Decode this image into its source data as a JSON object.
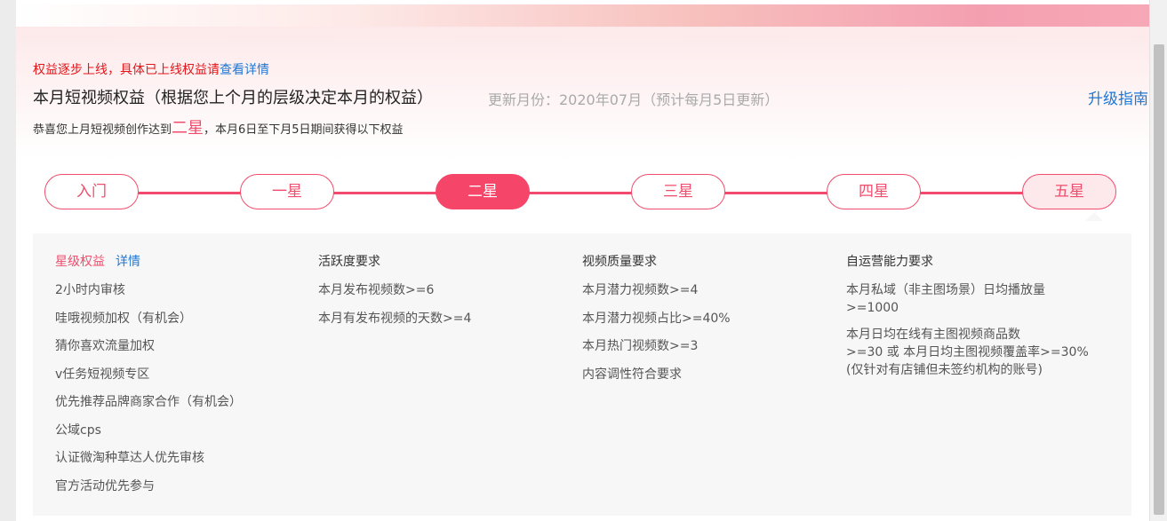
{
  "notice": {
    "text": "权益逐步上线，具体已上线权益请",
    "link": "查看详情"
  },
  "header": {
    "title": "本月短视频权益（根据您上个月的层级决定本月的权益）",
    "update_info": "更新月份：2020年07月（预计每月5日更新）",
    "upgrade_link": "升级指南"
  },
  "congrats": {
    "prefix": "恭喜您上月短视频创作达到",
    "level": "二星",
    "suffix": "，本月6日至下月5日期间获得以下权益"
  },
  "levels": [
    "入门",
    "一星",
    "二星",
    "三星",
    "四星",
    "五星"
  ],
  "active_level": "二星",
  "columns": {
    "benefits": {
      "title": "星级权益",
      "detail_link": "详情",
      "items": [
        "2小时内审核",
        "哇哦视频加权（有机会）",
        "猜你喜欢流量加权",
        "v任务短视频专区",
        "优先推荐品牌商家合作（有机会）",
        "公域cps",
        "认证微淘种草达人优先审核",
        "官方活动优先参与"
      ]
    },
    "activity": {
      "title": "活跃度要求",
      "items": [
        "本月发布视频数>=6",
        "本月有发布视频的天数>=4"
      ]
    },
    "quality": {
      "title": "视频质量要求",
      "items": [
        "本月潜力视频数>=4",
        "本月潜力视频占比>=40%",
        "本月热门视频数>=3",
        "内容调性符合要求"
      ]
    },
    "operation": {
      "title": "自运营能力要求",
      "items": [
        {
          "line1": "本月私域（非主图场景）日均播放量",
          "line2": ">=1000"
        },
        {
          "line1": "本月日均在线有主图视频商品数",
          "line2": ">=30 或 本月日均主图视频覆盖率>=30%",
          "line3": "(仅针对有店铺但未签约机构的账号)"
        }
      ]
    }
  },
  "colors": {
    "accent": "#f04d6d",
    "link": "#1f77d4",
    "notice": "#e4161b"
  }
}
